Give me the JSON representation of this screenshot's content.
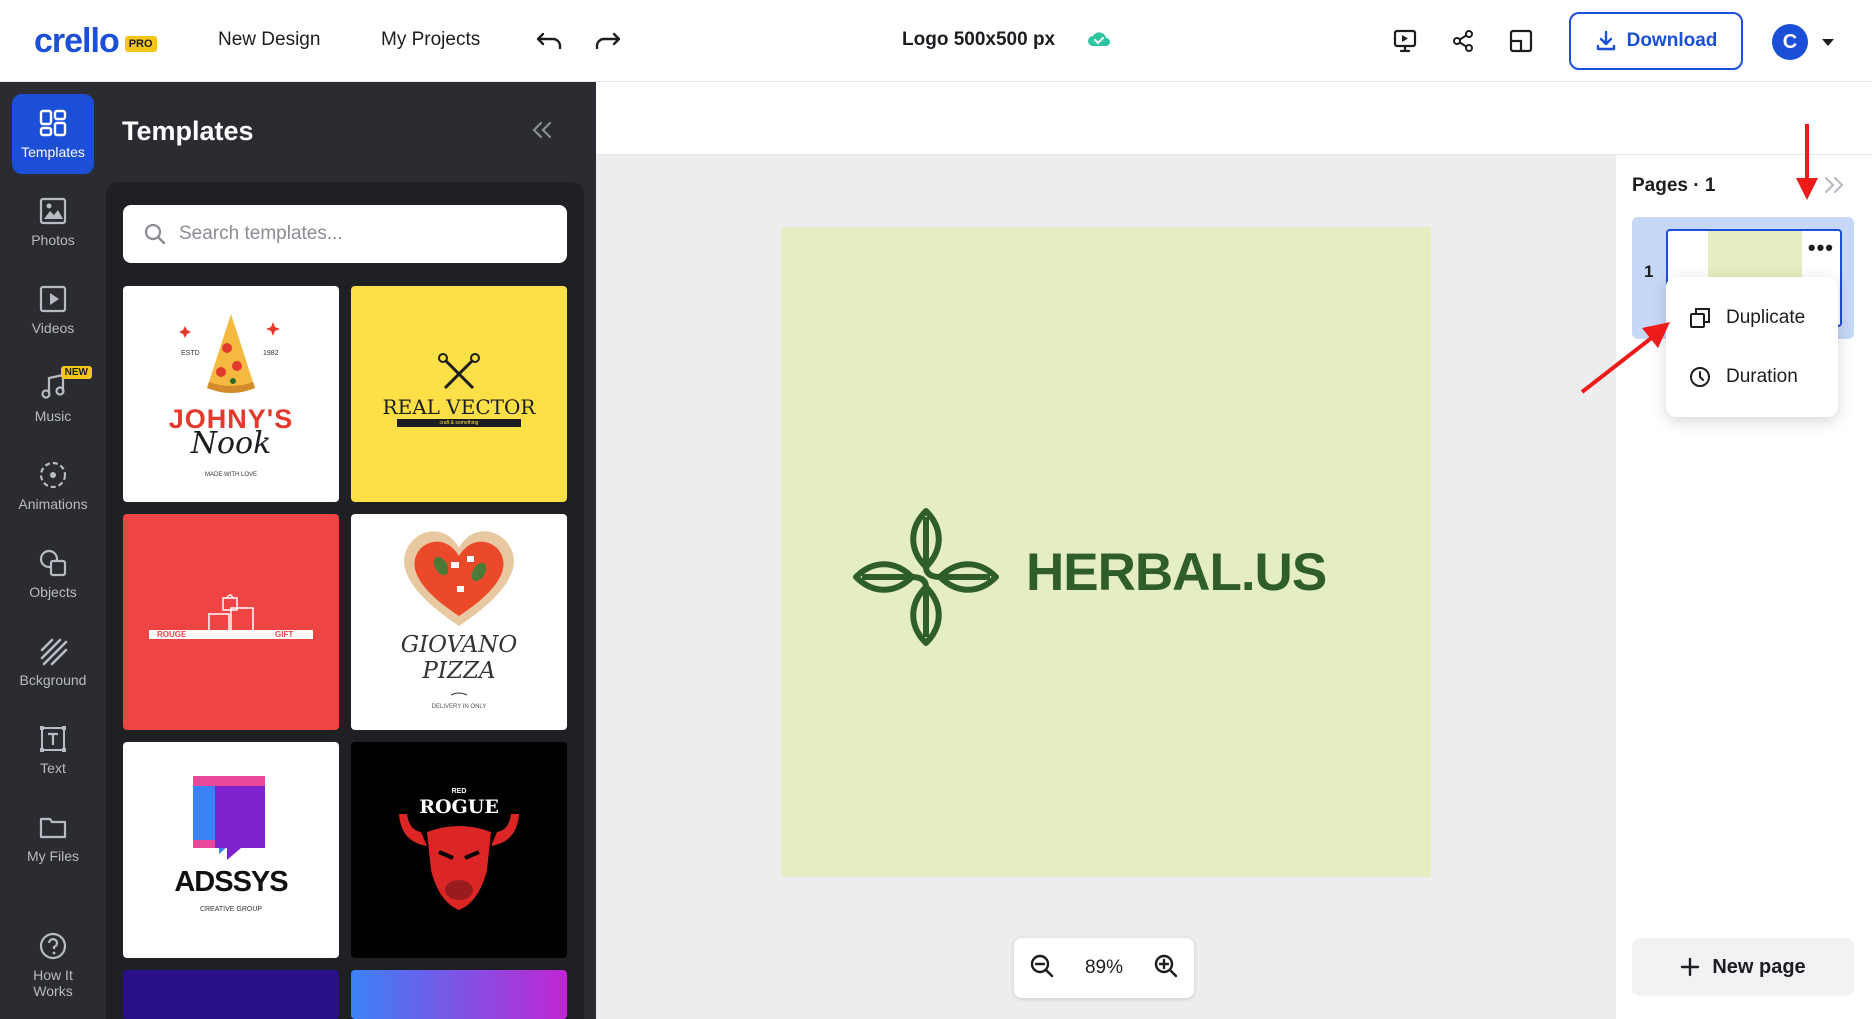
{
  "app": {
    "logo_text": "crello",
    "logo_badge": "PRO"
  },
  "topbar": {
    "new_design": "New Design",
    "my_projects": "My Projects",
    "doc_title": "Logo 500x500 px",
    "download_label": "Download",
    "avatar_initial": "C"
  },
  "rail": {
    "items": [
      {
        "label": "Templates"
      },
      {
        "label": "Photos"
      },
      {
        "label": "Videos"
      },
      {
        "label": "Music",
        "badge": "NEW"
      },
      {
        "label": "Animations"
      },
      {
        "label": "Objects"
      },
      {
        "label": "Bckground"
      },
      {
        "label": "Text"
      },
      {
        "label": "My Files"
      },
      {
        "label": "How It Works"
      }
    ]
  },
  "panel": {
    "title": "Templates",
    "search_placeholder": "Search templates...",
    "templates": [
      {
        "name": "JOHNY'S",
        "sub": "Nook",
        "tagline": "MADE WITH LOVE",
        "est_left": "ESTD",
        "est_right": "1982"
      },
      {
        "name": "REAL VECTOR",
        "tagline": "craft & something"
      },
      {
        "name_left": "ROUGE",
        "name_right": "GIFT"
      },
      {
        "name": "GIOVANO",
        "sub": "PIZZA",
        "tagline": "DELIVERY IN ONLY"
      },
      {
        "name": "ADSSYS",
        "tagline": "CREATIVE GROUP"
      },
      {
        "name": "ROGUE",
        "pre": "RED"
      }
    ]
  },
  "canvas": {
    "brand_text": "HERBAL.US",
    "zoom": "89%",
    "colors": {
      "artboard": "#e5eec2",
      "brand": "#2f5e2b"
    }
  },
  "pages": {
    "title": "Pages",
    "count_text": "· 1",
    "page_number": "1",
    "more": "•••",
    "menu": [
      "Duplicate",
      "Duration"
    ],
    "new_page": "New page"
  }
}
